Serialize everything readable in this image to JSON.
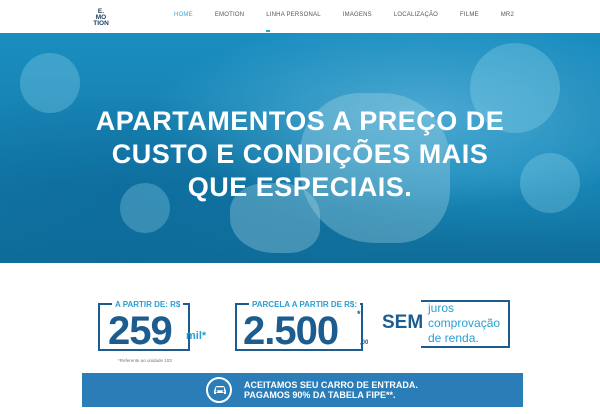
{
  "logo": {
    "line1": "E.",
    "line2": "MO",
    "line3": "TION"
  },
  "nav": {
    "items": [
      "HOME",
      "EMOTION",
      "LINHA PERSONAL",
      "IMAGENS",
      "LOCALIZAÇÃO",
      "FILME",
      "MR2"
    ],
    "active": "HOME"
  },
  "hero": {
    "title_line1": "APARTAMENTOS A PREÇO DE",
    "title_line2": "CUSTO E CONDIÇÕES MAIS",
    "title_line3": "QUE ESPECIAIS."
  },
  "offers": {
    "price_label": "A PARTIR DE: R$",
    "price_value": "259",
    "price_unit": "mil*",
    "price_note": "*Referente ao unidade 103",
    "installment_label": "PARCELA A PARTIR DE R$:",
    "installment_value": "2.500",
    "installment_cents": ",00",
    "installment_mark": "*",
    "sem": "SEM",
    "juros_line1": "juros",
    "juros_line2": "comprovação",
    "juros_line3": "de renda."
  },
  "banner": {
    "line1": "ACEITAMOS SEU CARRO DE ENTRADA.",
    "line2": "PAGAMOS 90% DA TABELA FIPE**.",
    "icon": "car-icon"
  },
  "colors": {
    "accent": "#2fa8d5",
    "brand": "#1d5c8f",
    "banner": "#2a7db7"
  }
}
